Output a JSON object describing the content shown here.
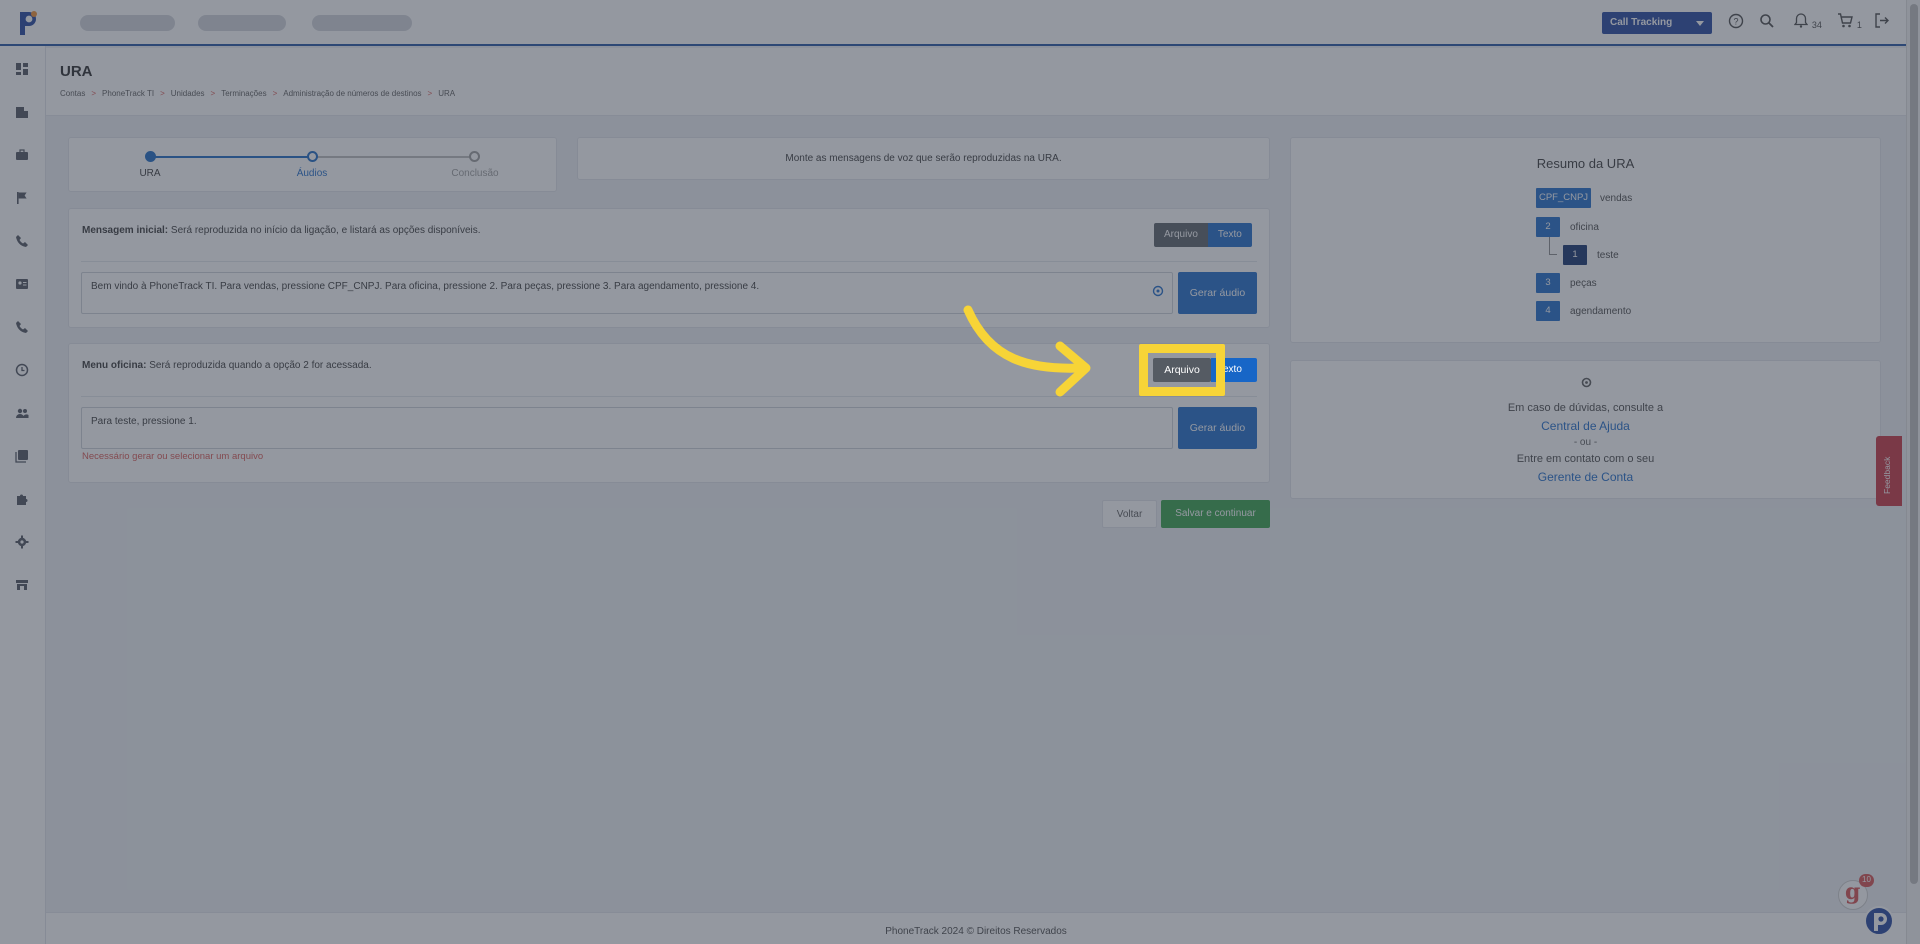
{
  "topbar": {
    "call_tracking_label": "Call Tracking",
    "notif_count": "34",
    "cart_count": "1",
    "icons": [
      "help-icon",
      "search-icon",
      "bell-icon",
      "cart-icon",
      "logout-icon"
    ]
  },
  "sidebar": {
    "items": [
      "dashboard-icon",
      "building-icon",
      "briefcase-icon",
      "flag-icon",
      "phone-icon",
      "contact-card-icon",
      "phone-call-icon",
      "history-icon",
      "users-icon",
      "library-icon",
      "puzzle-icon",
      "settings-icon",
      "store-icon"
    ]
  },
  "page": {
    "title": "URA",
    "breadcrumbs": [
      "Contas",
      "PhoneTrack TI",
      "Unidades",
      "Terminações",
      "Administração de números de destinos",
      "URA"
    ]
  },
  "stepper": {
    "steps": [
      "URA",
      "Áudios",
      "Conclusão"
    ]
  },
  "banner": "Monte as mensagens de voz que serão reproduzidas na URA.",
  "messages": [
    {
      "title": "Mensagem inicial:",
      "description": " Será reproduzida no início da ligação, e listará as opções disponíveis.",
      "text": "Bem vindo à PhoneTrack TI. Para vendas, pressione CPF_CNPJ. Para oficina, pressione 2. Para peças, pressione 3. Para agendamento, pressione 4.",
      "error": ""
    },
    {
      "title": "Menu oficina:",
      "description": " Será reproduzida quando a opção 2 for acessada.",
      "text": "Para teste, pressione 1.",
      "error": "Necessário gerar ou selecionar um arquivo"
    }
  ],
  "buttons": {
    "arquivo": "Arquivo",
    "texto": "Texto",
    "texto_partial": "exto",
    "gerar_audio": "Gerar áudio",
    "voltar": "Voltar",
    "salvar": "Salvar e continuar"
  },
  "summary": {
    "title": "Resumo da URA",
    "items": [
      {
        "key": "CPF_CNPJ",
        "label": "vendas"
      },
      {
        "key": "2",
        "label": "oficina"
      },
      {
        "key": "1",
        "label": "teste"
      },
      {
        "key": "3",
        "label": "peças"
      },
      {
        "key": "4",
        "label": "agendamento"
      }
    ]
  },
  "help": {
    "line1": "Em caso de dúvidas, consulte a",
    "link1": "Central de Ajuda",
    "or": "- ou -",
    "line2": "Entre em contato com o seu",
    "link2": "Gerente de Conta"
  },
  "footer": "PhoneTrack 2024 © Direitos Reservados",
  "feedback_label": "Feedback",
  "chat_badge": "10",
  "colors": {
    "primary": "#1766c7",
    "navy": "#1b3f9b",
    "success": "#2f9e44",
    "highlight": "#f7d437",
    "feedback": "#c62d3b"
  }
}
